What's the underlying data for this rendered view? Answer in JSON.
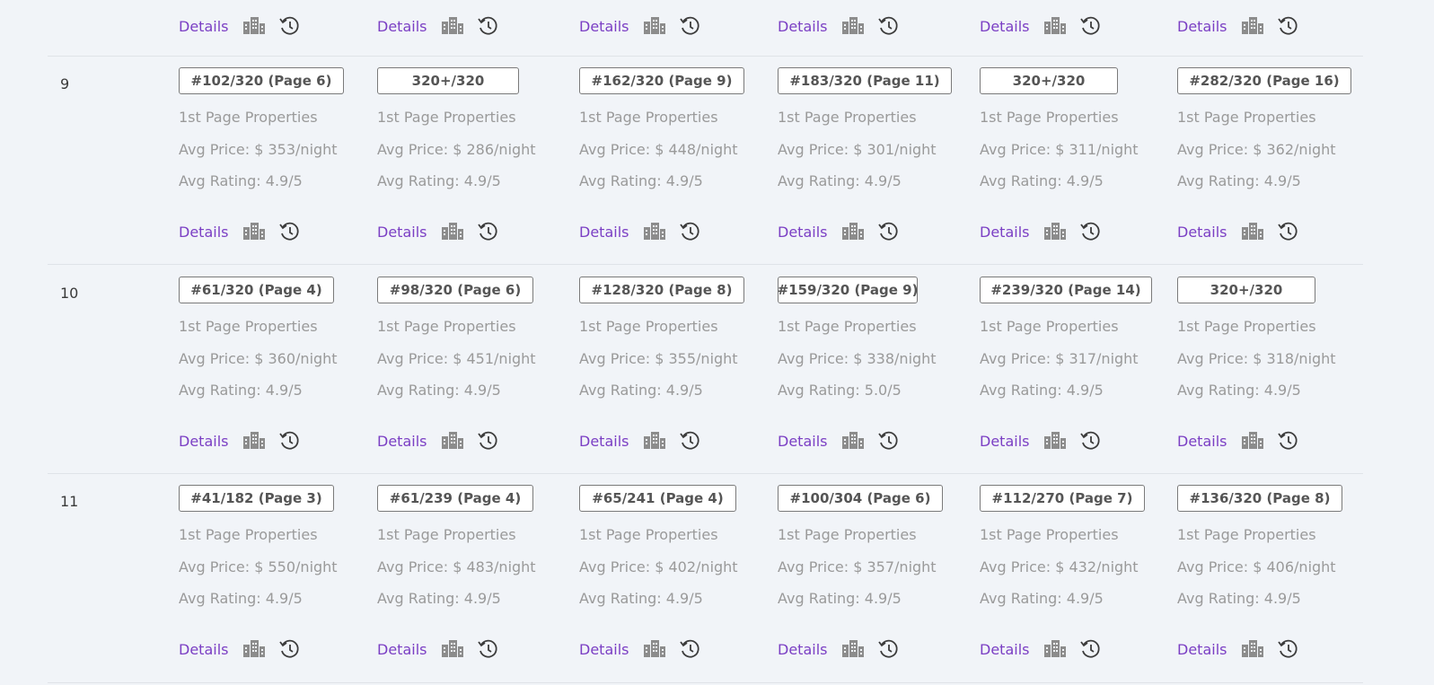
{
  "columns": 6,
  "top_row": {
    "cells": [
      {
        "details_label": "Details",
        "building_icon": "building-icon",
        "history_icon": "history-icon"
      },
      {
        "details_label": "Details",
        "building_icon": "building-icon",
        "history_icon": "history-icon"
      },
      {
        "details_label": "Details",
        "building_icon": "building-icon",
        "history_icon": "history-icon"
      },
      {
        "details_label": "Details",
        "building_icon": "building-icon",
        "history_icon": "history-icon"
      },
      {
        "details_label": "Details",
        "building_icon": "building-icon",
        "history_icon": "history-icon"
      },
      {
        "details_label": "Details",
        "building_icon": "building-icon",
        "history_icon": "history-icon"
      }
    ]
  },
  "rows": [
    {
      "number": "9",
      "cells": [
        {
          "rank": "#102/320 (Page 6)",
          "first_page": "1st Page Properties",
          "avg_price": "Avg Price: $ 353/night",
          "avg_rating": "Avg Rating: 4.9/5",
          "details_label": "Details"
        },
        {
          "rank": "320+/320",
          "first_page": "1st Page Properties",
          "avg_price": "Avg Price: $ 286/night",
          "avg_rating": "Avg Rating: 4.9/5",
          "details_label": "Details"
        },
        {
          "rank": "#162/320 (Page 9)",
          "first_page": "1st Page Properties",
          "avg_price": "Avg Price: $ 448/night",
          "avg_rating": "Avg Rating: 4.9/5",
          "details_label": "Details"
        },
        {
          "rank": "#183/320 (Page 11)",
          "first_page": "1st Page Properties",
          "avg_price": "Avg Price: $ 301/night",
          "avg_rating": "Avg Rating: 4.9/5",
          "details_label": "Details"
        },
        {
          "rank": "320+/320",
          "first_page": "1st Page Properties",
          "avg_price": "Avg Price: $ 311/night",
          "avg_rating": "Avg Rating: 4.9/5",
          "details_label": "Details"
        },
        {
          "rank": "#282/320 (Page 16)",
          "first_page": "1st Page Properties",
          "avg_price": "Avg Price: $ 362/night",
          "avg_rating": "Avg Rating: 4.9/5",
          "details_label": "Details"
        }
      ]
    },
    {
      "number": "10",
      "cells": [
        {
          "rank": "#61/320 (Page 4)",
          "first_page": "1st Page Properties",
          "avg_price": "Avg Price: $ 360/night",
          "avg_rating": "Avg Rating: 4.9/5",
          "details_label": "Details"
        },
        {
          "rank": "#98/320 (Page 6)",
          "first_page": "1st Page Properties",
          "avg_price": "Avg Price: $ 451/night",
          "avg_rating": "Avg Rating: 4.9/5",
          "details_label": "Details"
        },
        {
          "rank": "#128/320 (Page 8)",
          "first_page": "1st Page Properties",
          "avg_price": "Avg Price: $ 355/night",
          "avg_rating": "Avg Rating: 4.9/5",
          "details_label": "Details"
        },
        {
          "rank": "#159/320 (Page 9)",
          "first_page": "1st Page Properties",
          "avg_price": "Avg Price: $ 338/night",
          "avg_rating": "Avg Rating: 5.0/5",
          "details_label": "Details"
        },
        {
          "rank": "#239/320 (Page 14)",
          "first_page": "1st Page Properties",
          "avg_price": "Avg Price: $ 317/night",
          "avg_rating": "Avg Rating: 4.9/5",
          "details_label": "Details"
        },
        {
          "rank": "320+/320",
          "first_page": "1st Page Properties",
          "avg_price": "Avg Price: $ 318/night",
          "avg_rating": "Avg Rating: 4.9/5",
          "details_label": "Details"
        }
      ]
    },
    {
      "number": "11",
      "cells": [
        {
          "rank": "#41/182 (Page 3)",
          "first_page": "1st Page Properties",
          "avg_price": "Avg Price: $ 550/night",
          "avg_rating": "Avg Rating: 4.9/5",
          "details_label": "Details"
        },
        {
          "rank": "#61/239 (Page 4)",
          "first_page": "1st Page Properties",
          "avg_price": "Avg Price: $ 483/night",
          "avg_rating": "Avg Rating: 4.9/5",
          "details_label": "Details"
        },
        {
          "rank": "#65/241 (Page 4)",
          "first_page": "1st Page Properties",
          "avg_price": "Avg Price: $ 402/night",
          "avg_rating": "Avg Rating: 4.9/5",
          "details_label": "Details"
        },
        {
          "rank": "#100/304 (Page 6)",
          "first_page": "1st Page Properties",
          "avg_price": "Avg Price: $ 357/night",
          "avg_rating": "Avg Rating: 4.9/5",
          "details_label": "Details"
        },
        {
          "rank": "#112/270 (Page 7)",
          "first_page": "1st Page Properties",
          "avg_price": "Avg Price: $ 432/night",
          "avg_rating": "Avg Rating: 4.9/5",
          "details_label": "Details"
        },
        {
          "rank": "#136/320 (Page 8)",
          "first_page": "1st Page Properties",
          "avg_price": "Avg Price: $ 406/night",
          "avg_rating": "Avg Rating: 4.9/5",
          "details_label": "Details"
        }
      ]
    }
  ],
  "colors": {
    "background": "#f1f4f8",
    "link": "#7b3fc4",
    "muted_text": "#9a9a9a",
    "icon": "#8c8c8c",
    "separator": "#dfe3e8"
  }
}
